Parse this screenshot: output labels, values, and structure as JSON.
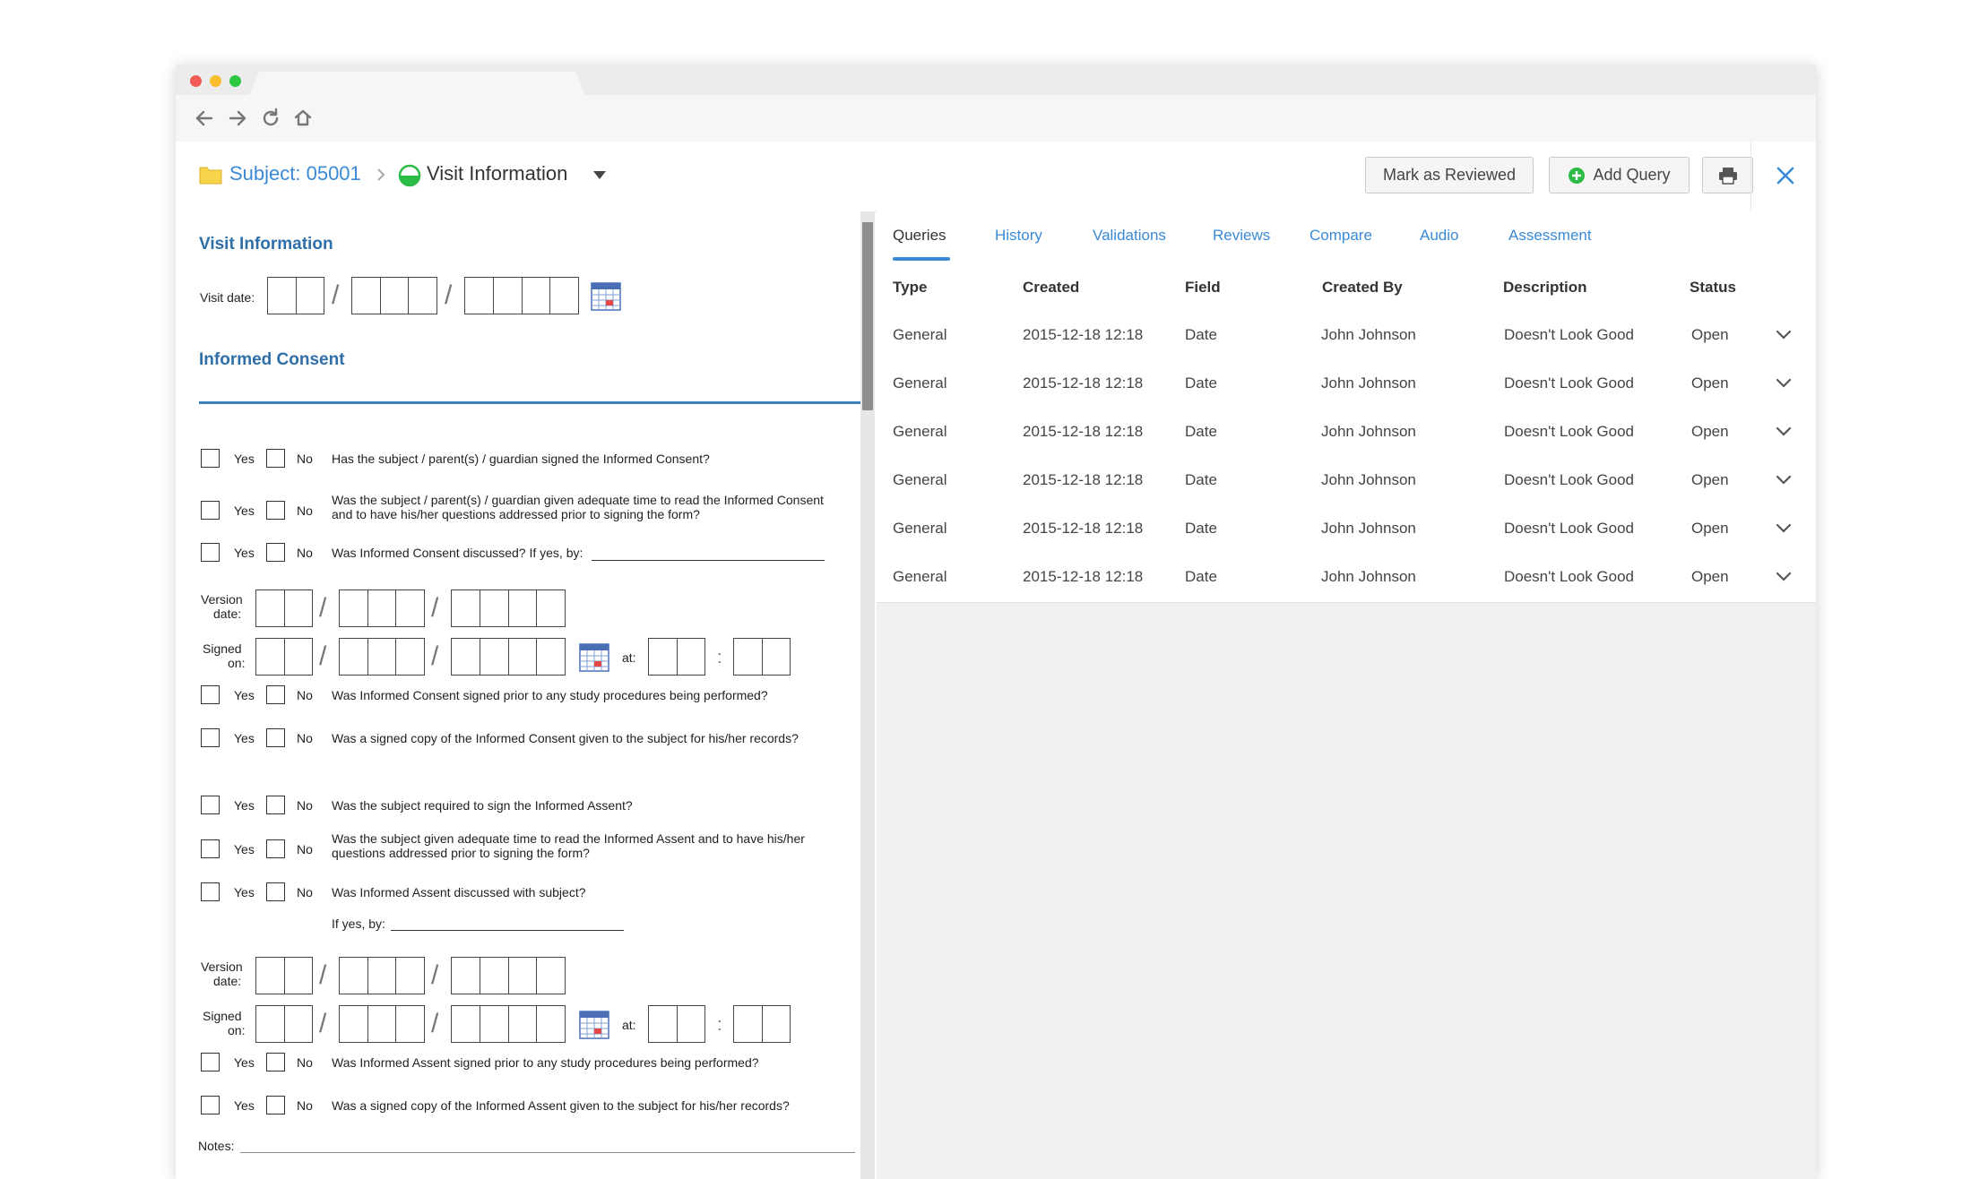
{
  "browser": {
    "dots": [
      "#f25b55",
      "#f9bd2e",
      "#2dc840"
    ],
    "nav_icons": [
      "back-arrow-icon",
      "forward-arrow-icon",
      "reload-icon",
      "home-icon"
    ]
  },
  "header": {
    "subject_label": "Subject: 05001",
    "visit_title": "Visit Information",
    "mark_reviewed": "Mark as Reviewed",
    "add_query": "Add Query"
  },
  "form": {
    "visit_section": "Visit Information",
    "visit_date_label": "Visit date:",
    "consent_section": "Informed Consent",
    "yes": "Yes",
    "no": "No",
    "questions": [
      "Has the subject / parent(s) / guardian signed the Informed Consent?",
      "Was the subject / parent(s) / guardian given adequate time to read the Informed Consent and to have his/her questions addressed prior to signing the form?",
      "Was Informed Consent discussed? If yes, by:",
      "Was Informed Consent signed prior to any study procedures being performed?",
      "Was a signed copy of the Informed Consent given to the subject for his/her records?",
      "Was the subject required to sign the Informed Assent?",
      "Was the subject given adequate time to read the Informed Assent and to have his/her questions addressed prior to signing the form?",
      "Was Informed Assent discussed with subject?",
      "Was Informed Assent signed prior to any study procedures being performed?",
      "Was a signed copy of the Informed Assent given to the subject for his/her records?"
    ],
    "if_yes_by": "If yes, by:",
    "version_label_1": "Version",
    "version_label_2": "date:",
    "signed_label_1": "Signed",
    "signed_label_2": "on:",
    "at_label": "at:",
    "notes_label": "Notes:"
  },
  "panel": {
    "tabs": [
      "Queries",
      "History",
      "Validations",
      "Reviews",
      "Compare",
      "Audio",
      "Assessment"
    ],
    "active_tab": "Queries",
    "columns": [
      "Type",
      "Created",
      "Field",
      "Created By",
      "Description",
      "Status"
    ],
    "rows": [
      [
        "General",
        "2015-12-18 12:18",
        "Date",
        "John Johnson",
        "Doesn't Look Good",
        "Open"
      ],
      [
        "General",
        "2015-12-18 12:18",
        "Date",
        "John Johnson",
        "Doesn't Look Good",
        "Open"
      ],
      [
        "General",
        "2015-12-18 12:18",
        "Date",
        "John Johnson",
        "Doesn't Look Good",
        "Open"
      ],
      [
        "General",
        "2015-12-18 12:18",
        "Date",
        "John Johnson",
        "Doesn't Look Good",
        "Open"
      ],
      [
        "General",
        "2015-12-18 12:18",
        "Date",
        "John Johnson",
        "Doesn't Look Good",
        "Open"
      ],
      [
        "General",
        "2015-12-18 12:18",
        "Date",
        "John Johnson",
        "Doesn't Look Good",
        "Open"
      ]
    ]
  },
  "colors": {
    "accent": "#3a8ad6",
    "section_blue": "#2f6fa9",
    "status_green": "#2dbb48",
    "folder_yellow": "#f7d44a"
  }
}
